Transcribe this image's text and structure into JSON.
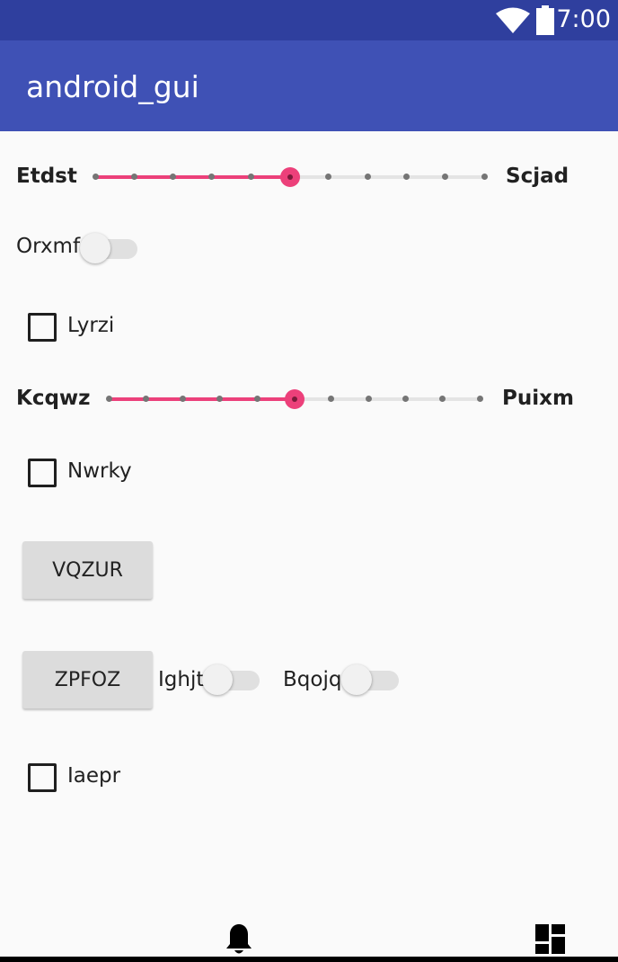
{
  "status_bar": {
    "time": "7:00",
    "icons": [
      "wifi-icon",
      "battery-icon"
    ],
    "background": "#2f3f9e"
  },
  "app_bar": {
    "title": "android_gui",
    "background": "#3f51b5"
  },
  "accent_color": "#ec407a",
  "controls": {
    "slider1": {
      "left_label": "Etdst",
      "right_label": "Scjad",
      "steps": 10,
      "value": 5
    },
    "switch1": {
      "label": "Orxmf",
      "checked": false
    },
    "checkbox1": {
      "label": "Lyrzi",
      "checked": false
    },
    "slider2": {
      "left_label": "Kcqwz",
      "right_label": "Puixm",
      "steps": 10,
      "value": 5
    },
    "checkbox2": {
      "label": "Nwrky",
      "checked": false
    },
    "button1": {
      "label": "VQZUR"
    },
    "button2": {
      "label": "ZPFOZ"
    },
    "switch2": {
      "label": "Ighjt",
      "checked": false
    },
    "switch3": {
      "label": "Bqojq",
      "checked": false
    },
    "checkbox3": {
      "label": "Iaepr",
      "checked": false
    }
  },
  "bottom_nav": {
    "items": [
      "bell-icon",
      "dashboard-icon"
    ]
  }
}
